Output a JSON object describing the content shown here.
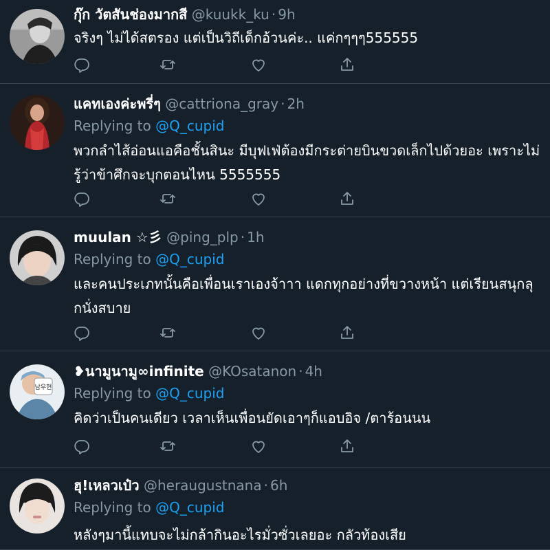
{
  "tweets": [
    {
      "name": "กุ๊ก วัตสันช่องมากสี",
      "handle": "@kuukk_ku",
      "time": "9h",
      "replying_label": "",
      "replying_to": "",
      "lines": [
        "จริงๆ ไม่ได้สตรอง แต่เป็นวิถีเด็กอ้วนค่ะ.. แค่กๆๆๆ555555"
      ]
    },
    {
      "name": "แคทเองค่ะพรี่ๆ",
      "handle": "@cattriona_gray",
      "time": "2h",
      "replying_label": "Replying to",
      "replying_to": "@Q_cupid",
      "lines": [
        "พวกลำไส้อ่อนแอคือชั้นสินะ มีบุฟเฟ่ต้องมีกระต่ายบินขวดเล็กไปด้วยอะ เพราะไม่",
        "รู้ว่าข้าศึกจะบุกตอนไหน 5555555"
      ]
    },
    {
      "name": "muulan ☆彡",
      "handle": "@ping_plp",
      "time": "1h",
      "replying_label": "Replying to",
      "replying_to": "@Q_cupid",
      "lines": [
        "และคนประเภทนั้นคือเพื่อนเราเองจ้าาา แดกทุกอย่างที่ขวางหน้า แต่เรียนสนุกลุ",
        "กนั่งสบาย"
      ]
    },
    {
      "name": "❥นามูนามู∞infinite",
      "handle": "@KOsatanon",
      "time": "4h",
      "replying_label": "Replying to",
      "replying_to": "@Q_cupid",
      "lines": [
        "คิดว่าเป็นคนเดียว เวลาเห็นเพื่อนยัดเอาๆก็แอบอิจ /ตาร้อนนน"
      ]
    },
    {
      "name": "ฮุ!เหลวเป๋ว",
      "handle": "@heraugustnana",
      "time": "6h",
      "replying_label": "Replying to",
      "replying_to": "@Q_cupid",
      "lines": [
        "หลังๆมานี้แทบจะไม่กล้ากินอะไรมั่วซั่วเลยอะ กลัวท้องเสีย"
      ]
    }
  ],
  "dot": "·",
  "icons": [
    "reply-icon",
    "retweet-icon",
    "like-icon",
    "share-icon"
  ],
  "colors": {
    "background": "#15202b",
    "text": "#ffffff",
    "secondary": "#8899a6",
    "link": "#1da1f2",
    "divider": "#38444d"
  }
}
